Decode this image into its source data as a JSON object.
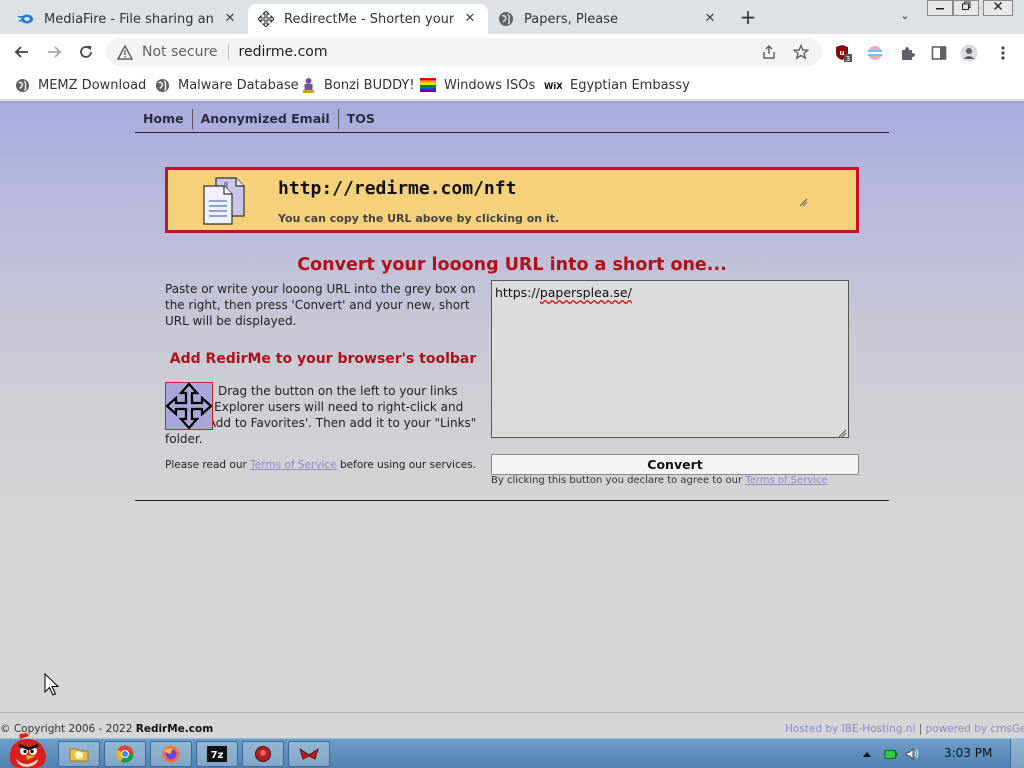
{
  "browser": {
    "tabs": [
      {
        "title": "MediaFire - File sharing and st",
        "icon": "mediafire-icon",
        "active": false
      },
      {
        "title": "RedirectMe - Shorten your UR",
        "icon": "move-arrows-icon",
        "active": true
      },
      {
        "title": "Papers, Please",
        "icon": "globe-icon",
        "active": false
      }
    ],
    "omnibox": {
      "security_label": "Not secure",
      "url": "redirme.com"
    },
    "bookmarks": [
      {
        "label": "MEMZ Download",
        "icon": "globe-icon"
      },
      {
        "label": "Malware Database",
        "icon": "globe-icon"
      },
      {
        "label": "Bonzi BUDDY!",
        "icon": "bonzi-icon"
      },
      {
        "label": "Windows ISOs",
        "icon": "rainbow-flag-icon"
      },
      {
        "label": "Egyptian Embassy",
        "icon": "wix-icon"
      }
    ],
    "extension_badge": "3"
  },
  "page": {
    "nav": [
      "Home",
      "Anonymized Email",
      "TOS"
    ],
    "short_url": "http://redirme.com/nft",
    "copy_hint": "You can copy the URL above by clicking on it.",
    "heading": "Convert your looong URL into a short one...",
    "instructions": "Paste or write your looong URL into the grey box on the right, then press 'Convert' and your new, short URL will be displayed.",
    "toolbar_heading": "Add RedirMe to your browser's toolbar",
    "drag_text": "Drag the button on the left to your links toolbar. Explorer users will need to right-click and select 'Add to Favorites'. Then add it to your \"Links\" folder.",
    "tos_note_before": "Please read our ",
    "tos_link": "Terms of Service",
    "tos_note_after": " before using our services.",
    "url_input_value_prefix": "https://",
    "url_input_value_rest": "papersplea.se/",
    "convert_label": "Convert",
    "convert_note_before": "By clicking this button you declare to agree to our ",
    "convert_note_link": "Terms of Service",
    "footer_copyright_prefix": "© Copyright 2006 - 2022 ",
    "footer_copyright_site": "RedirMe.com",
    "footer_hosted": "Hosted by IBE-Hosting.nl",
    "footer_sep": "|",
    "footer_powered": "powered by cmsGear"
  },
  "taskbar": {
    "items": [
      "file-explorer-icon",
      "chrome-icon",
      "firefox-icon",
      "7zip-icon",
      "app-red-icon",
      "app-wing-icon"
    ],
    "clock": "3:03 PM"
  },
  "colors": {
    "accent_red": "#b0101a",
    "box_yellow": "#f5d27a",
    "link_lavender": "#8b8bd0"
  }
}
